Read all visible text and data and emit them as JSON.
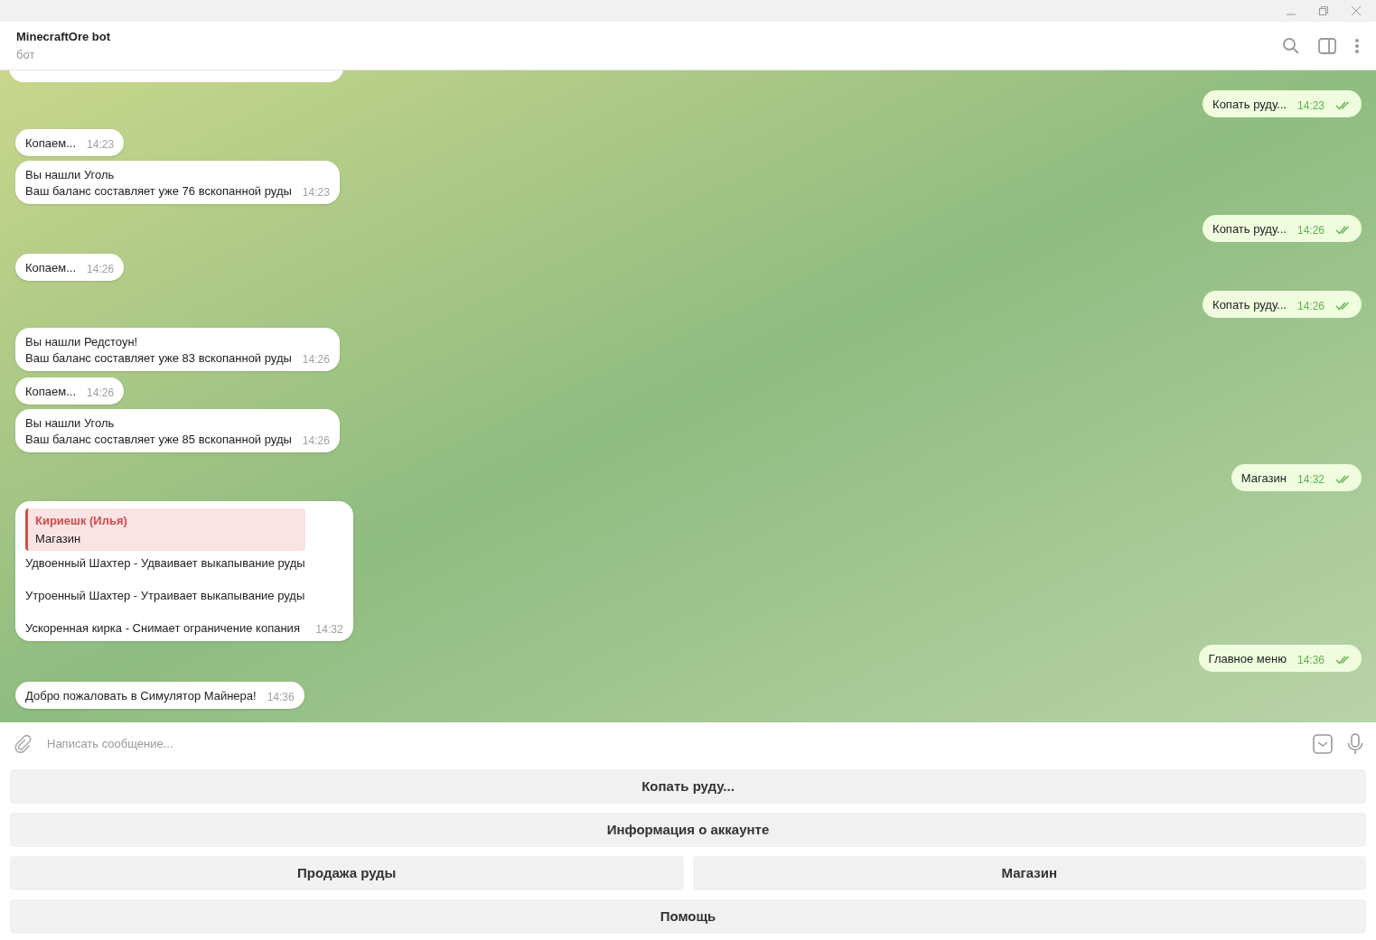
{
  "header": {
    "title": "MinecraftOre bot",
    "subtitle": "бот"
  },
  "incoming": [
    {
      "lines": [
        "Копаем..."
      ],
      "time": "14:23"
    },
    {
      "lines": [
        "Вы нашли Уголь",
        "Ваш баланс составляет уже 76 вскопанной руды"
      ],
      "time": "14:23"
    },
    {
      "lines": [
        "Копаем..."
      ],
      "time": "14:26"
    },
    {
      "lines": [
        "Вы нашли Редстоун!",
        "Ваш баланс составляет уже 83 вскопанной руды"
      ],
      "time": "14:26"
    },
    {
      "lines": [
        "Копаем..."
      ],
      "time": "14:26"
    },
    {
      "lines": [
        "Вы нашли Уголь",
        "Ваш баланс составляет уже 85 вскопанной руды"
      ],
      "time": "14:26"
    },
    {
      "reply": {
        "author": "Кириешк (Илья)",
        "text": "Магазин"
      },
      "spaced": true,
      "lines": [
        "Удвоенный Шахтер - Удваивает выкапывание руды",
        "Утроенный Шахтер - Утраивает выкапывание руды",
        "Ускоренная кирка - Снимает ограничение копания"
      ],
      "time": "14:32"
    },
    {
      "lines": [
        "Добро пожаловать в Симулятор Майнера!"
      ],
      "time": "14:36"
    }
  ],
  "outgoing": [
    {
      "text": "Копать руду...",
      "time": "14:23",
      "read": true
    },
    {
      "text": "Копать руду...",
      "time": "14:26",
      "read": true
    },
    {
      "text": "Копать руду...",
      "time": "14:26",
      "read": true
    },
    {
      "text": "Магазин",
      "time": "14:32",
      "read": true
    },
    {
      "text": "Главное меню",
      "time": "14:36",
      "read": true
    }
  ],
  "composer": {
    "placeholder": "Написать сообщение..."
  },
  "keyboard": [
    [
      "Копать руду..."
    ],
    [
      "Информация о аккаунте"
    ],
    [
      "Продажа руды",
      "Магазин"
    ],
    [
      "Помощь"
    ]
  ]
}
